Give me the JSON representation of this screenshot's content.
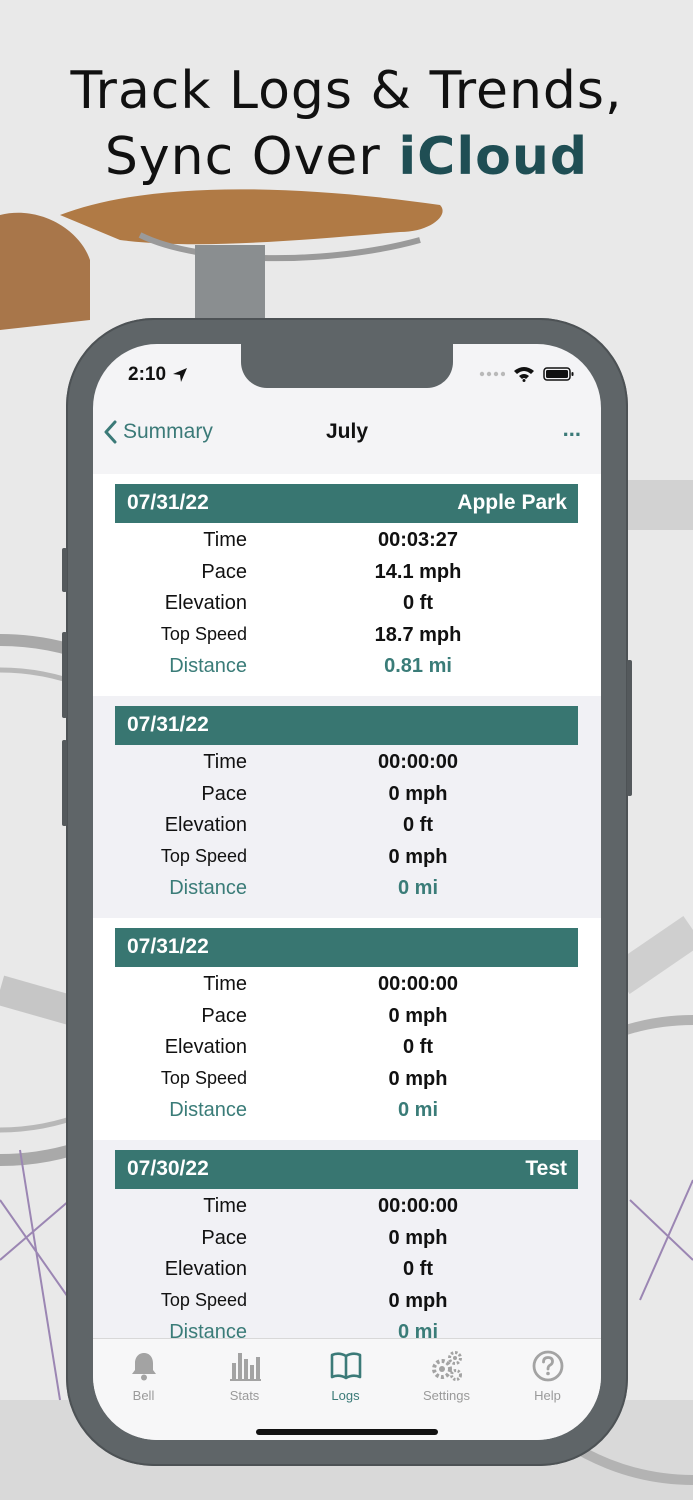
{
  "headline": {
    "line1": "Track Logs & Trends,",
    "line2_prefix": "Sync Over ",
    "line2_accent": "iCloud"
  },
  "status": {
    "time": "2:10"
  },
  "nav": {
    "back_label": "Summary",
    "title": "July",
    "more_label": "..."
  },
  "field_labels": {
    "time": "Time",
    "pace": "Pace",
    "elevation": "Elevation",
    "top_speed": "Top Speed",
    "distance": "Distance"
  },
  "logs": [
    {
      "date": "07/31/22",
      "location": "Apple Park",
      "time": "00:03:27",
      "pace": "14.1 mph",
      "elevation": "0 ft",
      "top_speed": "18.7 mph",
      "distance": "0.81 mi"
    },
    {
      "date": "07/31/22",
      "location": "",
      "time": "00:00:00",
      "pace": "0 mph",
      "elevation": "0 ft",
      "top_speed": "0 mph",
      "distance": "0 mi"
    },
    {
      "date": "07/31/22",
      "location": "",
      "time": "00:00:00",
      "pace": "0 mph",
      "elevation": "0 ft",
      "top_speed": "0 mph",
      "distance": "0 mi"
    },
    {
      "date": "07/30/22",
      "location": "Test",
      "time": "00:00:00",
      "pace": "0 mph",
      "elevation": "0 ft",
      "top_speed": "0 mph",
      "distance": "0 mi"
    }
  ],
  "tabs": [
    {
      "label": "Bell",
      "icon": "bell-icon"
    },
    {
      "label": "Stats",
      "icon": "bar-chart-icon"
    },
    {
      "label": "Logs",
      "icon": "book-icon",
      "active": true
    },
    {
      "label": "Settings",
      "icon": "gears-icon"
    },
    {
      "label": "Help",
      "icon": "question-circle-icon"
    }
  ],
  "colors": {
    "accent": "#387671",
    "accent_text": "#3b7a78",
    "headline_accent": "#1f4e54"
  }
}
